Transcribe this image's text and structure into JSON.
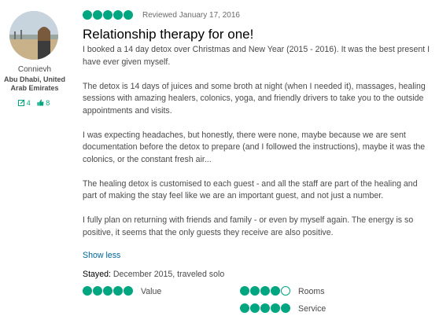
{
  "reviewer": {
    "username": "Connievh",
    "location": "Abu Dhabi, United Arab Emirates",
    "review_count": "4",
    "helpful_votes": "8"
  },
  "review": {
    "rating": 5,
    "reviewed_date": "Reviewed January 17, 2016",
    "title": "Relationship therapy for one!",
    "paragraphs": [
      "I booked a 14 day detox over Christmas and New Year (2015 - 2016). It was the best present I have ever given myself.",
      "The detox is 14 days of juices and some broth at night (when I needed it), massages, healing sessions with amazing healers, colonics, yoga, and friendly drivers to take you to the outside appointments and visits.",
      "I was expecting headaches, but honestly, there were none, maybe because we are sent documentation before the detox to prepare (and I followed the instructions), maybe it was the colonics, or the constant fresh air...",
      "The healing detox is customised to each guest - and all the staff are part of the healing and part of making the stay feel like we are an important guest, and not just a number.",
      "I fully plan on returning with friends and family - or even by myself again. The energy is so positive, it seems that the only guests they receive are also positive."
    ],
    "show_less": "Show less",
    "stayed_label": "Stayed:",
    "stayed_value": "December 2015, traveled solo"
  },
  "sub_ratings": [
    {
      "label": "Value",
      "rating": 5
    },
    {
      "label": "Rooms",
      "rating": 4
    },
    {
      "label": "Service",
      "rating": 5
    }
  ],
  "colors": {
    "accent": "#00a680",
    "link": "#006699"
  }
}
